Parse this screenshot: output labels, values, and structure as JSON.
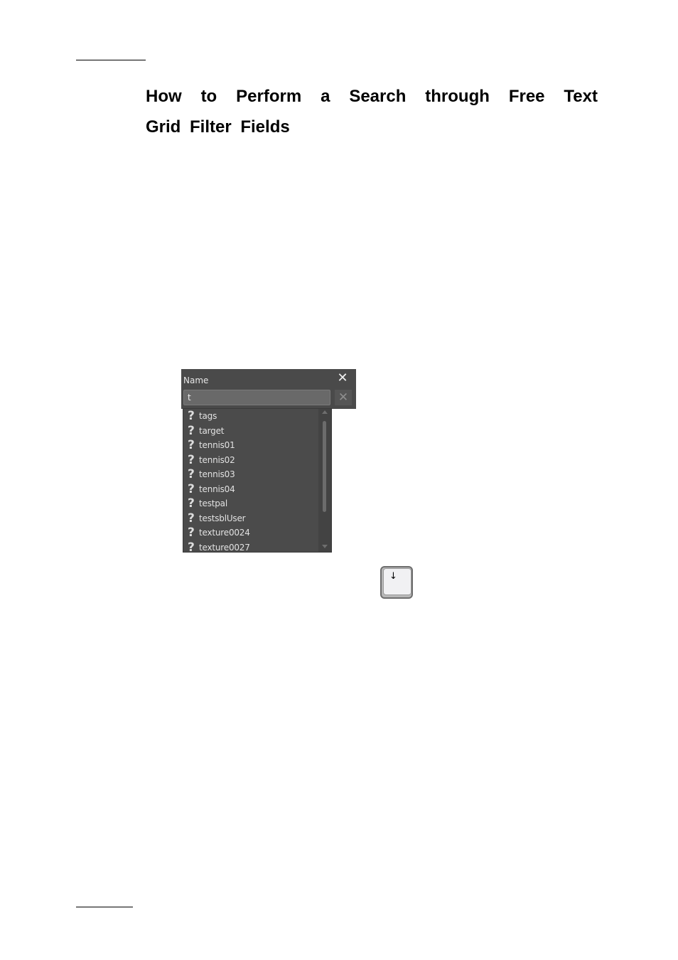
{
  "document": {
    "heading_line1": "How to Perform a Search through Free Text",
    "heading_line2": "Grid Filter Fields"
  },
  "filter_panel": {
    "column_title": "Name",
    "close_icon": "close-icon",
    "input_value": "t",
    "clear_icon": "clear-icon"
  },
  "autocomplete": {
    "item_icon": "question-mark-icon",
    "items": [
      {
        "icon": "?",
        "label": "tags"
      },
      {
        "icon": "?",
        "label": "target"
      },
      {
        "icon": "?",
        "label": "tennis01"
      },
      {
        "icon": "?",
        "label": "tennis02"
      },
      {
        "icon": "?",
        "label": "tennis03"
      },
      {
        "icon": "?",
        "label": "tennis04"
      },
      {
        "icon": "?",
        "label": "testpal"
      },
      {
        "icon": "?",
        "label": "testsblUser"
      },
      {
        "icon": "?",
        "label": "texture0024"
      },
      {
        "icon": "?",
        "label": "texture0027"
      }
    ]
  },
  "keyboard_key": {
    "symbol": "↓",
    "meaning": "down-arrow-key"
  },
  "glyphs": {
    "close": "✕",
    "clear": "✕"
  }
}
